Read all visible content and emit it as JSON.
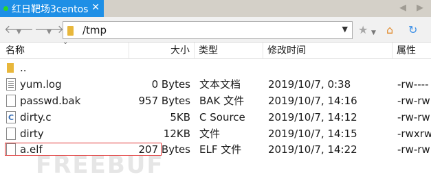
{
  "tab": {
    "title": "红日靶场3centos",
    "close": "✕"
  },
  "tabbar": {
    "left_arrow": "◀",
    "right_arrow": "▶"
  },
  "toolbar": {
    "back_icon": "arrow-left-icon",
    "forward_icon": "arrow-right-icon",
    "path": "/tmp",
    "dropdown": "▼",
    "bookmark_icon": "star-icon",
    "home_icon": "home-icon",
    "refresh_icon": "refresh-icon"
  },
  "columns": {
    "name": "名称",
    "size": "大小",
    "type": "类型",
    "modified": "修改时间",
    "attr": "属性"
  },
  "files": [
    {
      "name": "..",
      "size": "",
      "type": "",
      "modified": "",
      "attr": "",
      "icon": "folder-icon"
    },
    {
      "name": "yum.log",
      "size": "0 Bytes",
      "type": "文本文档",
      "modified": "2019/10/7, 0:38",
      "attr": "-rw----",
      "icon": "text-file-icon"
    },
    {
      "name": "passwd.bak",
      "size": "957 Bytes",
      "type": "BAK 文件",
      "modified": "2019/10/7, 14:16",
      "attr": "-rw-rw",
      "icon": "file-icon"
    },
    {
      "name": "dirty.c",
      "size": "5KB",
      "type": "C Source",
      "modified": "2019/10/7, 14:12",
      "attr": "-rw-rw",
      "icon": "c-file-icon"
    },
    {
      "name": "dirty",
      "size": "12KB",
      "type": "文件",
      "modified": "2019/10/7, 14:15",
      "attr": "-rwxrw",
      "icon": "file-icon"
    },
    {
      "name": "a.elf",
      "size": "207 Bytes",
      "type": "ELF 文件",
      "modified": "2019/10/7, 14:22",
      "attr": "-rw-rw",
      "icon": "file-icon"
    }
  ],
  "watermark": "FREEBUF",
  "colors": {
    "tab": "#1e8fe6",
    "highlight": "#e03030"
  }
}
